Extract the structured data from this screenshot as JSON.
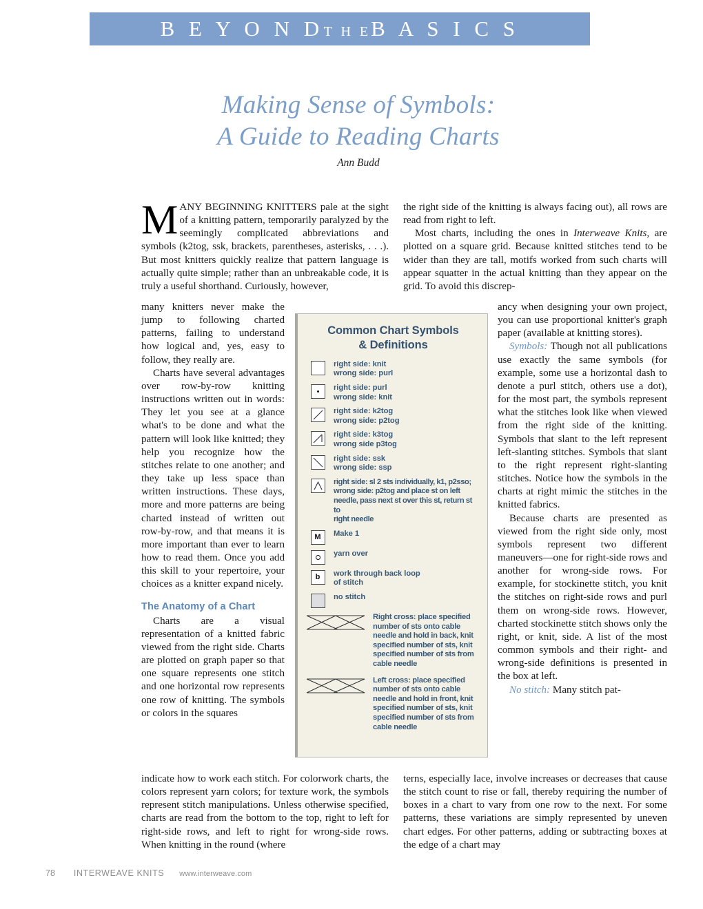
{
  "banner": {
    "word1": "B E Y O N D",
    "word2": "T H E",
    "word3": "B A S I C S",
    "color": "#7fa0cc"
  },
  "title": {
    "line1": "Making Sense of Symbols:",
    "line2": "A Guide to Reading Charts",
    "byline": "Ann Budd",
    "color": "#7b9ec9"
  },
  "article": {
    "dropcap": "M",
    "left_top": "ANY BEGINNING KNITTERS pale at the sight of a knitting pattern, temporarily paralyzed by the seemingly complicated abbreviations and symbols (k2tog, ssk, brackets, parentheses, asterisks, . . .). But most knitters quickly realize that pattern language is actually quite simple; rather than an unbreakable code, it is truly a useful shorthand. Curiously, however,",
    "left_narrow_p1": "many knitters never make the jump to following charted patterns, failing to understand how logical and, yes, easy to follow, they really are.",
    "left_narrow_p2": "Charts have several advantages over row-by-row knitting instructions written out in words: They let you see at a glance what's to be done and what the pattern will look like knitted; they help you recognize how the stitches relate to one another; and they take up less space than written instructions. These days, more and more patterns are being charted instead of written out row-by-row, and that means it is more important than ever to learn how to read them. Once you add this skill to your repertoire, your choices as a knitter expand nicely.",
    "anatomy_heading": "The Anatomy of a Chart",
    "left_narrow_p3": "Charts are a visual representation of a knitted fabric viewed from the right side. Charts are plotted on graph paper so that one square represents one stitch and one horizontal row represents one row of knitting. The symbols or colors in the squares",
    "left_bottom": "indicate how to work each stitch. For colorwork charts, the colors represent yarn colors; for texture work, the symbols represent stitch manipulations. Unless otherwise specified, charts are read from the bottom to the top, right to left for right-side rows, and left to right for wrong-side rows. When knitting in the round (where",
    "right_top_p1": "the right side of the knitting is always facing out), all rows are read from right to left.",
    "right_top_p2_a": "Most charts, including the ones in ",
    "right_top_p2_italic": "Interweave Knits",
    "right_top_p2_b": ", are plotted on a square grid. Because knitted stitches tend to be wider than they are tall, motifs worked from such charts will appear squatter in the actual knitting than they appear on the grid. To avoid this discrep-",
    "right_narrow_p1": "ancy when designing your own project, you can use proportional knitter's graph paper (available at knitting stores).",
    "symbols_runin": "Symbols:",
    "right_narrow_p2": " Though not all publications use exactly the same symbols (for example, some use a horizontal dash to denote a purl stitch, others use a dot), for the most part, the symbols represent what the stitches look like when viewed from the right side of the knitting. Symbols that slant to the left represent left-slanting stitches. Symbols that slant to the right represent right-slanting stitches. Notice how the symbols in the charts at right mimic the stitches in the knitted fabrics.",
    "right_narrow_p3": "Because charts are presented as viewed from the right side only, most symbols represent two different maneuvers—one for right-side rows and another for wrong-side rows. For example, for stockinette stitch, you knit the stitches on right-side rows and purl them on wrong-side rows. However, charted stockinette stitch shows only the right, or knit, side. A list of the most common symbols and their right- and wrong-side definitions is presented in the box at left.",
    "nostitch_runin": "No stitch:",
    "right_narrow_p4": " Many stitch pat-",
    "right_bottom": "terns, especially lace, involve increases or decreases that cause the stitch count to rise or fall, thereby requiring the number of boxes in a chart to vary from one row to the next. For some patterns, these variations are simply represented by uneven chart edges. For other patterns, adding or subtracting boxes at the edge of a chart may"
  },
  "sidebar": {
    "title_line1": "Common Chart Symbols",
    "title_line2": "& Definitions",
    "background": "#f3f1e6",
    "text_color": "#3a5a79",
    "symbols": [
      {
        "icon": "empty-square-icon",
        "glyph": "",
        "line1": "right side: knit",
        "line2": "wrong side: purl"
      },
      {
        "icon": "purl-dot-icon",
        "glyph": "dot",
        "line1": "right side: purl",
        "line2": "wrong side: knit"
      },
      {
        "icon": "k2tog-slash-icon",
        "glyph": "slash",
        "line1": "right side: k2tog",
        "line2": "wrong side: p2tog"
      },
      {
        "icon": "k3tog-slash-tick-icon",
        "glyph": "slash-tick",
        "line1": "right side: k3tog",
        "line2": "wrong side p3tog"
      },
      {
        "icon": "ssk-backslash-icon",
        "glyph": "backslash",
        "line1": "right side: ssk",
        "line2": "wrong side: ssp"
      },
      {
        "icon": "double-decrease-chevron-icon",
        "glyph": "chevron",
        "line1": "right side: sl 2 sts individually, k1, p2sso;",
        "line2": "wrong side: p2tog and place st on left",
        "line3": "needle, pass next st over this st, return st to",
        "line4": "right needle"
      },
      {
        "icon": "make-one-icon",
        "glyph": "M",
        "line1": "Make 1"
      },
      {
        "icon": "yarn-over-icon",
        "glyph": "ring",
        "line1": "yarn over"
      },
      {
        "icon": "through-back-loop-icon",
        "glyph": "b",
        "line1": "work through back loop",
        "line2": "of stitch"
      },
      {
        "icon": "no-stitch-icon",
        "glyph": "filled",
        "line1": "no stitch"
      }
    ],
    "cables": [
      {
        "icon": "right-cross-cable-icon",
        "text": "Right cross: place specified number of sts onto cable needle and hold in back, knit specified number of sts, knit specified number of sts from cable needle"
      },
      {
        "icon": "left-cross-cable-icon",
        "text": "Left cross: place specified number of sts onto cable needle and hold in front, knit specified number of sts, knit specified number of sts from cable needle"
      }
    ]
  },
  "footer": {
    "page": "78",
    "publication": "INTERWEAVE KNITS",
    "url": "www.interweave.com"
  }
}
